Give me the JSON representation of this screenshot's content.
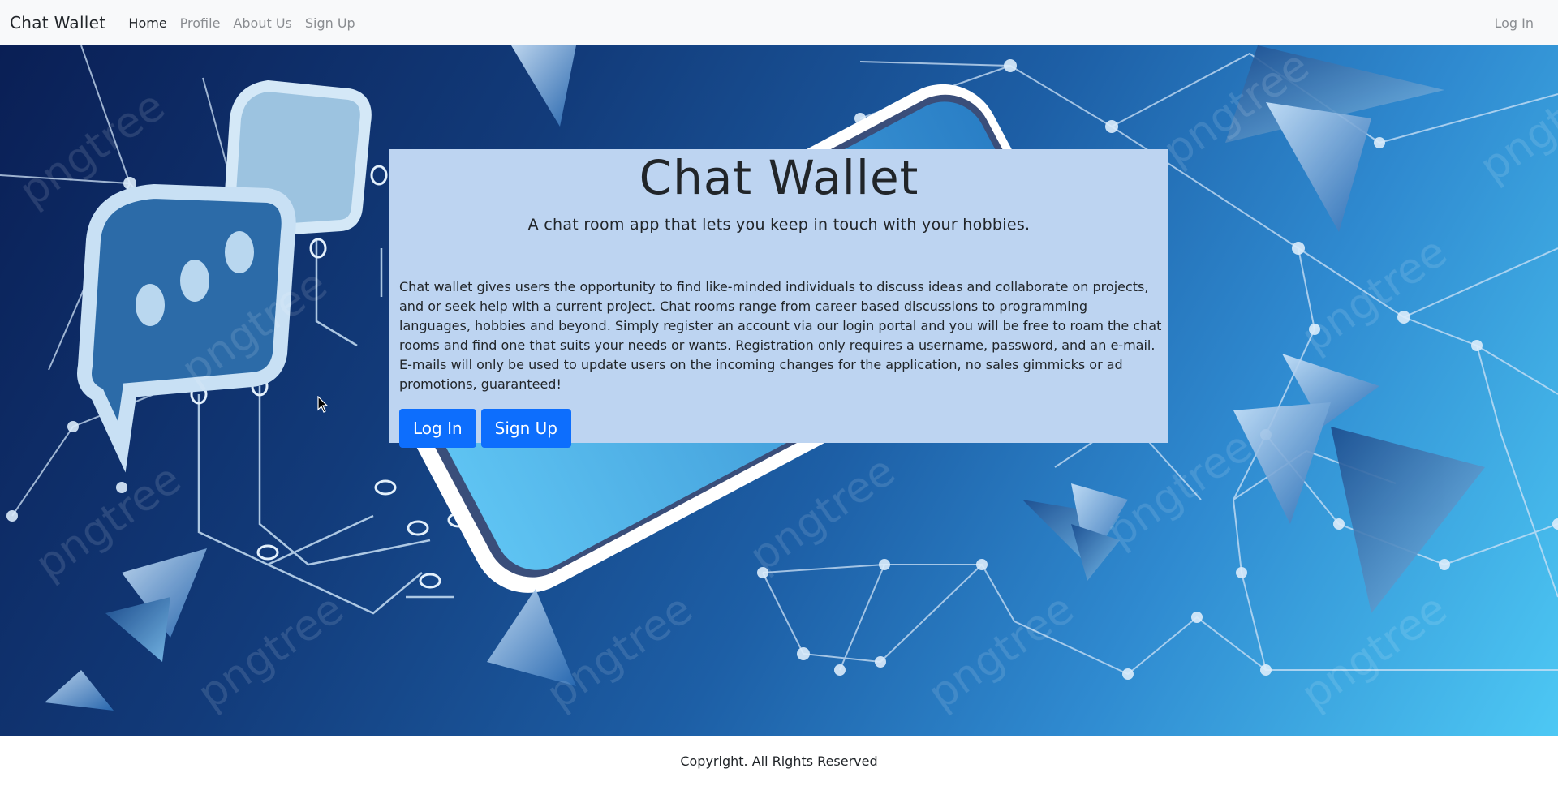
{
  "navbar": {
    "brand": "Chat Wallet",
    "links": [
      {
        "label": "Home",
        "active": true
      },
      {
        "label": "Profile",
        "active": false
      },
      {
        "label": "About Us",
        "active": false
      },
      {
        "label": "Sign Up",
        "active": false
      }
    ],
    "right_link": "Log In"
  },
  "hero": {
    "title": "Chat Wallet",
    "lead": "A chat room app that lets you keep in touch with your hobbies.",
    "body": "Chat wallet gives users the opportunity to find like-minded individuals to discuss ideas and collaborate on projects, and or seek help with a current project. Chat rooms range from career based discussions to programming languages, hobbies and beyond. Simply register an account via our login portal and you will be free to roam the chat rooms and find one that suits your needs or wants. Registration only requires a username, password, and an e-mail. E-mails will only be used to update users on the incoming changes for the application, no sales gimmicks or ad promotions, guaranteed!",
    "buttons": {
      "login": "Log In",
      "signup": "Sign Up"
    },
    "watermark": "pngtree"
  },
  "footer": {
    "text": "Copyright. All Rights Reserved"
  },
  "colors": {
    "primary": "#0d6efd",
    "navbar_bg": "#f8f9fa",
    "card_bg": "#bdd4f1"
  }
}
